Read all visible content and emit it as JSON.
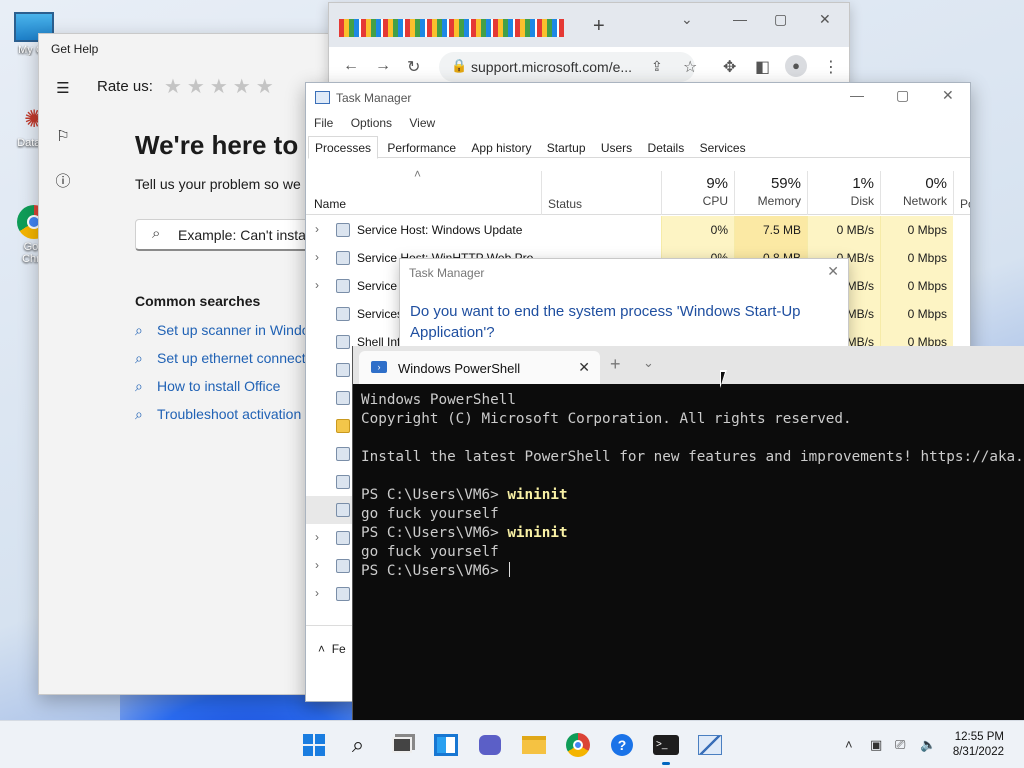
{
  "desktop": {
    "icons": [
      {
        "label": "My Co",
        "icon": "computer-icon"
      },
      {
        "label": "DataW",
        "icon": "datawrapper-icon"
      },
      {
        "label": "Goo​",
        "icon": "chrome-icon"
      }
    ],
    "icon_labels": {
      "computer": "My Co",
      "data": "DataW",
      "chrome1": "Goo",
      "chrome2": "Chro"
    }
  },
  "get_help": {
    "title": "Get Help",
    "rate_label": "Rate us:",
    "stars": "★★★★★",
    "heading": "We're here to",
    "subtitle": "Tell us your problem so we c",
    "search_placeholder": "Example: Can't instal",
    "common_searches_label": "Common searches",
    "links": [
      "Set up scanner in Windo",
      "Set up ethernet connect",
      "How to install Office",
      "Troubleshoot activation"
    ]
  },
  "chrome": {
    "url": "support.microsoft.com/e...",
    "new_tab": "+"
  },
  "task_manager": {
    "title": "Task Manager",
    "menu": [
      "File",
      "Options",
      "View"
    ],
    "tabs": [
      "Processes",
      "Performance",
      "App history",
      "Startup",
      "Users",
      "Details",
      "Services"
    ],
    "active_tab": "Processes",
    "columns": {
      "name": "Name",
      "status": "Status",
      "cpu": {
        "pct": "9%",
        "label": "CPU"
      },
      "memory": {
        "pct": "59%",
        "label": "Memory"
      },
      "disk": {
        "pct": "1%",
        "label": "Disk"
      },
      "network": {
        "pct": "0%",
        "label": "Network"
      },
      "power": "Po"
    },
    "rows": [
      {
        "name": "Service Host: Windows Update",
        "cpu": "0%",
        "memory": "7.5 MB",
        "disk": "0 MB/s",
        "network": "0 Mbps"
      },
      {
        "name": "Service Host: WinHTTP Web Pro",
        "cpu": "0%",
        "memory": "0.8 MB",
        "disk": "0 MB/s",
        "network": "0 Mbps"
      },
      {
        "name": "Service H",
        "cpu": "",
        "memory": "",
        "disk": "MB/s",
        "network": "0 Mbps"
      },
      {
        "name": "Services",
        "cpu": "",
        "memory": "",
        "disk": "MB/s",
        "network": "0 Mbps"
      },
      {
        "name": "Shell Inf",
        "cpu": "",
        "memory": "",
        "disk": "MB/s",
        "network": "0 Mbps"
      }
    ],
    "footer_label": "Fe"
  },
  "dialog": {
    "title": "Task Manager",
    "message": "Do you want to end the system process 'Windows Start-Up Application'?"
  },
  "terminal": {
    "tab_title": "Windows PowerShell",
    "lines": [
      {
        "text": "Windows PowerShell"
      },
      {
        "text": "Copyright (C) Microsoft Corporation. All rights reserved."
      },
      {
        "text": ""
      },
      {
        "text": "Install the latest PowerShell for new features and improvements! https://aka.ms/PSWindows"
      },
      {
        "text": ""
      },
      {
        "prompt": "PS C:\\Users\\VM6> ",
        "cmd": "wininit"
      },
      {
        "text": "go fuck yourself"
      },
      {
        "prompt": "PS C:\\Users\\VM6> ",
        "cmd": "wininit"
      },
      {
        "text": "go fuck yourself"
      },
      {
        "prompt": "PS C:\\Users\\VM6> ",
        "cmd": ""
      }
    ]
  },
  "taskbar": {
    "clock_time": "12:55 PM",
    "clock_date": "8/31/2022"
  }
}
